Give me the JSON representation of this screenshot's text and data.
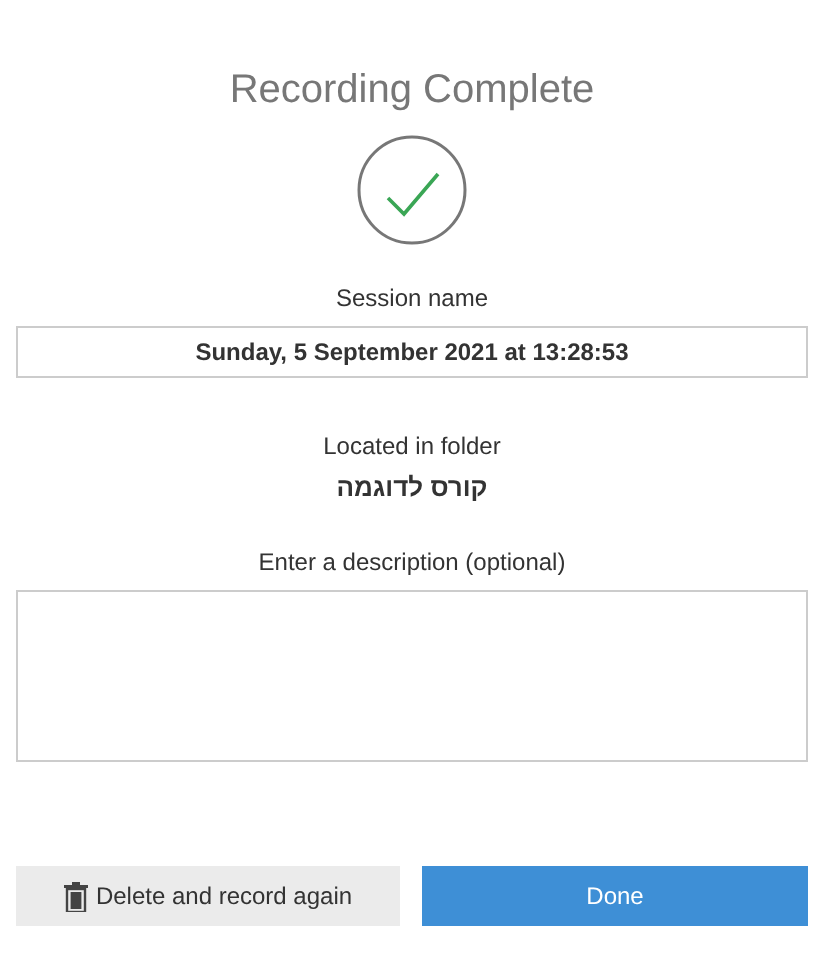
{
  "title": "Recording Complete",
  "session": {
    "label": "Session name",
    "value": "Sunday, 5 September 2021 at 13:28:53"
  },
  "folder": {
    "label": "Located in folder",
    "name": "קורס לדוגמה"
  },
  "description": {
    "label": "Enter a description (optional)"
  },
  "buttons": [
    {
      "label": "Delete and record again",
      "kind": "secondary"
    },
    {
      "label": "Done",
      "kind": "primary"
    }
  ]
}
